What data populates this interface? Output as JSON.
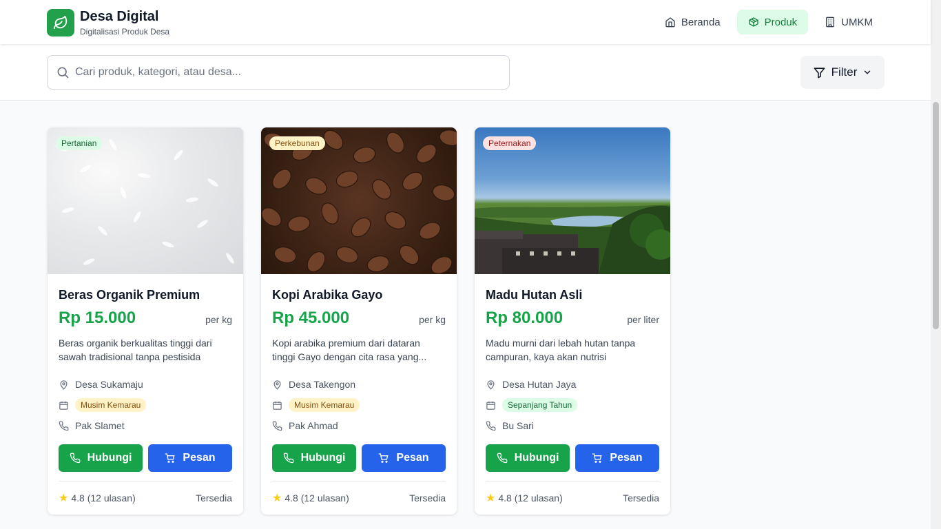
{
  "brand": {
    "title": "Desa Digital",
    "subtitle": "Digitalisasi Produk Desa",
    "icon": "leaf-icon",
    "color": "#22a04b"
  },
  "nav": [
    {
      "label": "Beranda",
      "icon": "home-icon",
      "active": false
    },
    {
      "label": "Produk",
      "icon": "package-icon",
      "active": true
    },
    {
      "label": "UMKM",
      "icon": "building-icon",
      "active": false
    }
  ],
  "search": {
    "placeholder": "Cari produk, kategori, atau desa...",
    "value": ""
  },
  "filter": {
    "label": "Filter"
  },
  "colors": {
    "primary_green": "#16a34a",
    "primary_blue": "#2563eb"
  },
  "products": [
    {
      "category": "Pertanian",
      "name": "Beras Organik Premium",
      "price": "Rp 15.000",
      "unit": "per kg",
      "description": "Beras organik berkualitas tinggi dari sawah tradisional tanpa pestisida",
      "village": "Desa Sukamaju",
      "season": "Musim Kemarau",
      "seller": "Pak Slamet",
      "contact_label": "Hubungi",
      "order_label": "Pesan",
      "rating": "4.8 (12 ulasan)",
      "status": "Tersedia"
    },
    {
      "category": "Perkebunan",
      "name": "Kopi Arabika Gayo",
      "price": "Rp 45.000",
      "unit": "per kg",
      "description": "Kopi arabika premium dari dataran tinggi Gayo dengan cita rasa yang...",
      "village": "Desa Takengon",
      "season": "Musim Kemarau",
      "seller": "Pak Ahmad",
      "contact_label": "Hubungi",
      "order_label": "Pesan",
      "rating": "4.8 (12 ulasan)",
      "status": "Tersedia"
    },
    {
      "category": "Peternakan",
      "name": "Madu Hutan Asli",
      "price": "Rp 80.000",
      "unit": "per liter",
      "description": "Madu murni dari lebah hutan tanpa campuran, kaya akan nutrisi",
      "village": "Desa Hutan Jaya",
      "season": "Sepanjang Tahun",
      "seller": "Bu Sari",
      "contact_label": "Hubungi",
      "order_label": "Pesan",
      "rating": "4.8 (12 ulasan)",
      "status": "Tersedia"
    }
  ]
}
